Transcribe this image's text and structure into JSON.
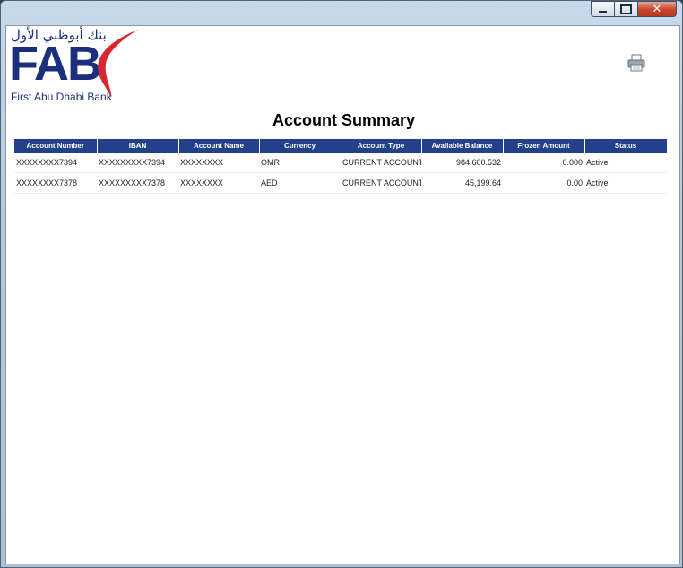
{
  "window": {
    "minimize_icon": "minimize-icon",
    "maximize_icon": "maximize-icon",
    "close_glyph": "✕"
  },
  "logo": {
    "arabic": "بنك أبوظبي الأول",
    "mark": "FAB",
    "name": "First Abu Dhabi Bank",
    "brand_color": "#1b2f7c",
    "accent_color": "#d7282f"
  },
  "toolbar": {
    "print_icon": "printer-icon"
  },
  "page": {
    "title": "Account Summary"
  },
  "table": {
    "header_color": "#23418a",
    "columns": [
      "Account Number",
      "IBAN",
      "Account Name",
      "Currency",
      "Account Type",
      "Available Balance",
      "Frozen Amount",
      "Status"
    ],
    "rows": [
      [
        "XXXXXXXX7394",
        "XXXXXXXXX7394",
        "XXXXXXXX",
        "OMR",
        "CURRENT ACCOUNT",
        "984,600.532",
        "0.000",
        "Active"
      ],
      [
        "XXXXXXXX7378",
        "XXXXXXXXX7378",
        "XXXXXXXX",
        "AED",
        "CURRENT ACCOUNT",
        "45,199.64",
        "0.00",
        "Active"
      ]
    ]
  }
}
